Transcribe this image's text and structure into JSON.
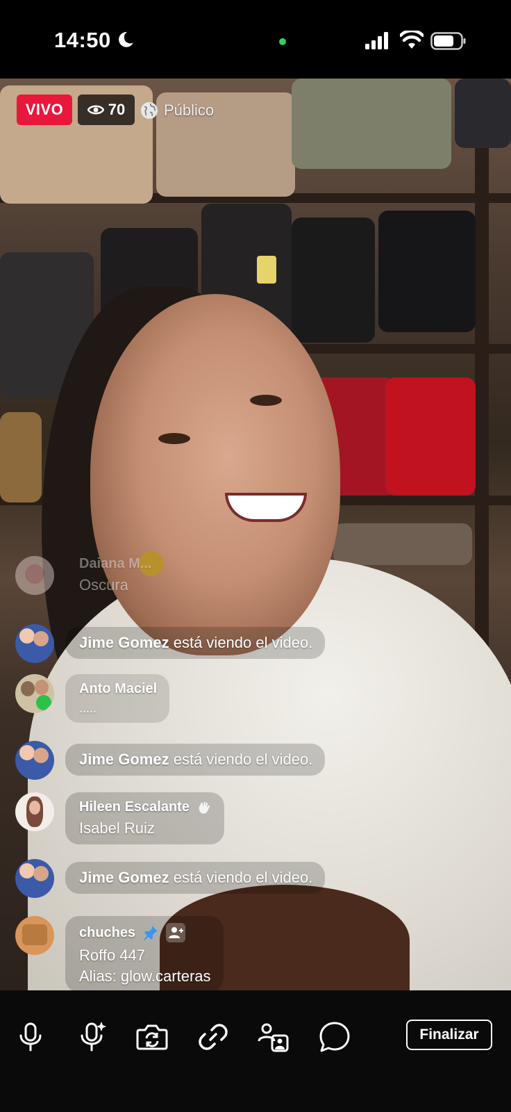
{
  "status": {
    "time": "14:50"
  },
  "live": {
    "badge": "VIVO",
    "viewers": "70",
    "privacy": "Público"
  },
  "comments": [
    {
      "name": "Daiana M...",
      "message": "Oscura",
      "faded": true
    },
    {
      "system_name": "Jime Gomez",
      "system_text": "está viendo el video."
    },
    {
      "name": "Anto Maciel",
      "message": "....."
    },
    {
      "system_name": "Jime Gomez",
      "system_text": "está viendo el video."
    },
    {
      "name": "Hileen Escalante",
      "message": "Isabel Ruiz",
      "icon": "wave-icon"
    },
    {
      "system_name": "Jime Gomez",
      "system_text": "está viendo el video."
    },
    {
      "name": "chuches",
      "message_lines": [
        "Roffo 447",
        "Alias: glow.carteras"
      ],
      "icons": [
        "pin-icon",
        "add-person-icon"
      ]
    }
  ],
  "toolbar": {
    "finalize_label": "Finalizar",
    "tools": [
      "microphone-icon",
      "voice-effect-icon",
      "flip-camera-icon",
      "link-icon",
      "guest-icon",
      "comment-icon"
    ]
  },
  "colors": {
    "live_red": "#e8173b",
    "pin_blue": "#3897f0"
  }
}
